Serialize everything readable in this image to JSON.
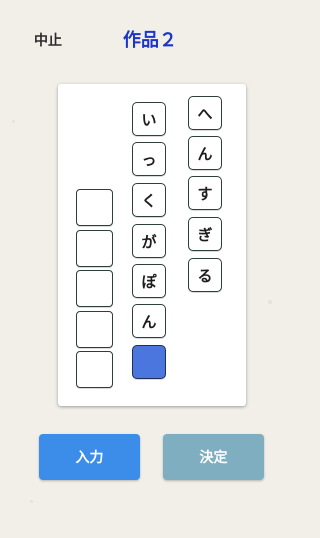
{
  "header": {
    "stop_label": "中止",
    "title": "作品２"
  },
  "columns": [
    {
      "id": "right",
      "tiles": [
        "へ",
        "ん",
        "す",
        "ぎ",
        "る"
      ]
    },
    {
      "id": "middle",
      "tiles": [
        "い",
        "っ",
        "く",
        "が",
        "ぽ",
        "ん",
        ""
      ],
      "cursor_index": 6
    },
    {
      "id": "left",
      "tiles": [
        "",
        "",
        "",
        "",
        ""
      ]
    }
  ],
  "buttons": {
    "input_label": "入力",
    "decide_label": "決定"
  },
  "colors": {
    "title": "#1b35c9",
    "cursor": "#4a76de",
    "input_button": "#3b8de9",
    "decide_button": "#7faec1"
  }
}
